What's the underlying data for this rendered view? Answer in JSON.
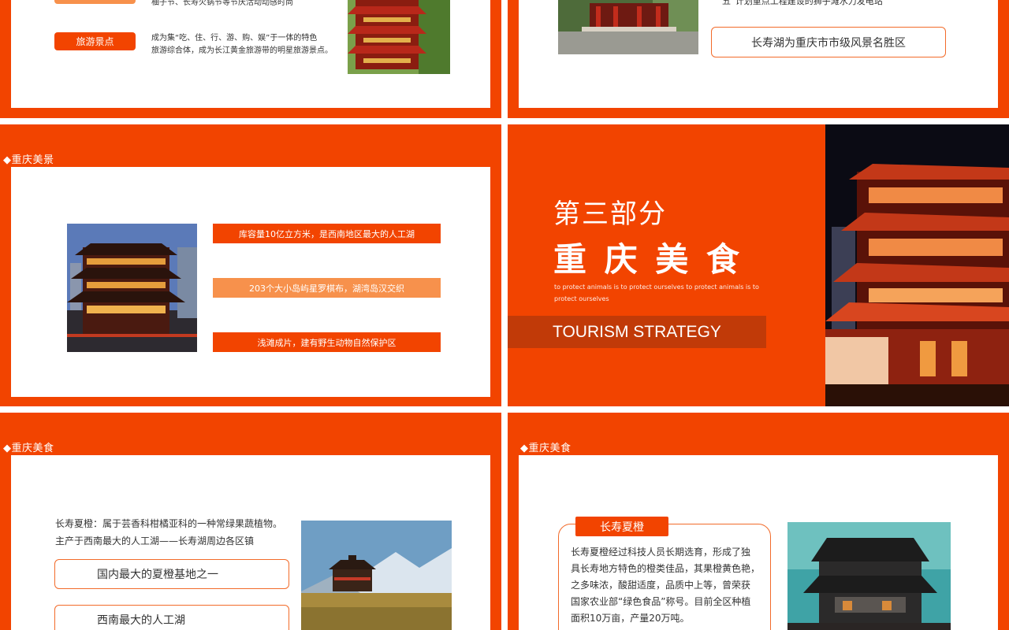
{
  "colors": {
    "orange": "#f24400",
    "light_orange": "#f7914c",
    "dark_bar": "#c13a08",
    "text": "#333333"
  },
  "slide1": {
    "text_top": "柚子节、长寿火锅节等节庆活动动感时尚",
    "pill_label": "旅游景点",
    "desc_line1": "成为集“吃、住、行、游、购、娱”于一体的特色",
    "desc_line2": "旅游综合体，成为长江黄金旅游带的明星旅游景点。",
    "photo_icon": "temple-photo"
  },
  "slide2": {
    "text_top": "五”计划重点工程建设的狮子滩水力发电站",
    "box_label": "长寿湖为重庆市市级风景名胜区",
    "photo_icon": "pavilion-photo"
  },
  "slide3": {
    "section_title": "◆重庆美景",
    "bars": [
      "库容量10亿立方米，是西南地区最大的人工湖",
      "203个大小岛屿星罗棋布，湖湾岛汉交织",
      "浅滩成片，建有野生动物自然保护区"
    ],
    "photo_icon": "buddha-tooth-temple-photo"
  },
  "slide4": {
    "part_label": "第三部分",
    "title": "重 庆 美 食",
    "tagline_line1": "to protect animals is to protect ourselves to protect animals is to",
    "tagline_line2": "protect ourselves",
    "banner": "TOURISM STRATEGY",
    "photo_icon": "night-temple-photo"
  },
  "slide5": {
    "section_title": "◆重庆美食",
    "desc_line1": "长寿夏橙：属于芸香科柑橘亚科的一种常绿果蔬植物。",
    "desc_line2": "主产于西南最大的人工湖——长寿湖周边各区镇",
    "boxes": [
      "国内最大的夏橙基地之一",
      "西南最大的人工湖"
    ],
    "photo_icon": "mountain-monastery-photo"
  },
  "slide6": {
    "section_title": "◆重庆美食",
    "tag": "长寿夏橙",
    "body_lines": [
      "长寿夏橙经过科技人员长期选育，形成了独",
      "具长寿地方特色的橙类佳品，其果橙黄色艳，",
      "之多味浓，酸甜适度，品质中上等，曾荣获",
      "国家农业部“绿色食品”称号。目前全区种植",
      "面积10万亩，产量20万吨。"
    ],
    "photo_icon": "chinese-building-photo"
  }
}
